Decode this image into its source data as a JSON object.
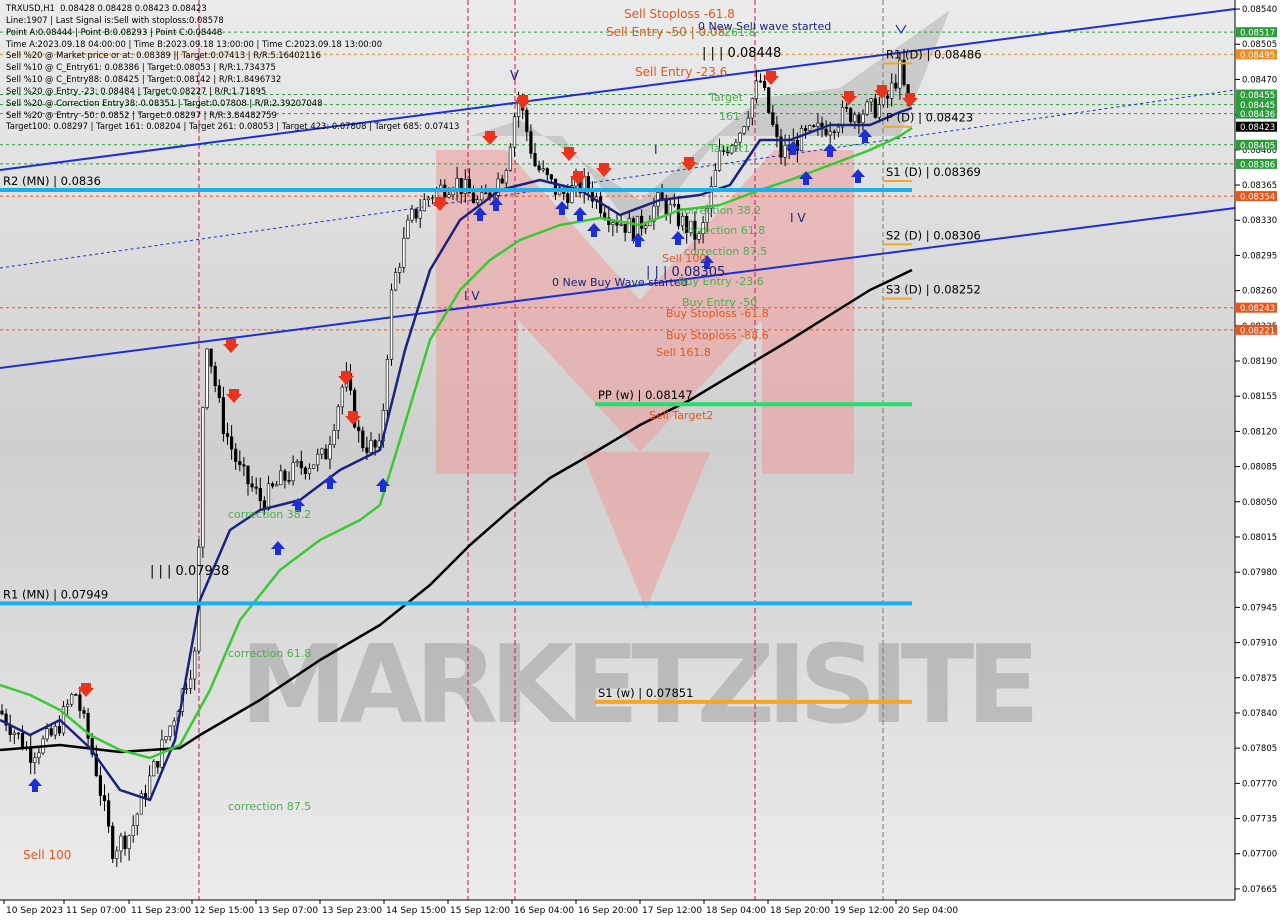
{
  "info_lines": [
    "TRXUSD,H1  0.08428 0.08428 0.08423 0.08423",
    "Line:1907 | Last Signal is:Sell with stoploss:0.08578",
    "Point A:0.08444 | Point B:0.08293 | Point C:0.08448",
    "Time A:2023.09.18 04:00:00 | Time B:2023.09.18 13:00:00 | Time C:2023.09.18 13:00:00",
    "Sell %20 @ Market price or at: 0.08389 || Target:0.07413 | R/R:5.16402116",
    "Sell %10 @ C_Entry61: 0.08386 | Target:0.08053 | R/R:1.734375",
    "Sell %10 @ C_Entry88: 0.08425 | Target:0.08142 | R/R:1.8496732",
    "Sell %20 @ Entry -23: 0.08484 | Target:0.08227 | R/R:1.71895",
    "Sell %20 @ Correction Entry38: 0.08351 | Target:0.07808 | R/R:2.39207048",
    "Sell %20 @ Entry -50: 0.0852 | Target:0.08297 | R/R:3.84482759",
    "Target100: 0.08297 | Target 161: 0.08204 | Target 261: 0.08053 | Target 423: 0.07808 | Target 685: 0.07413"
  ],
  "chart_data": {
    "type": "candlestick",
    "symbol": "TRXUSD",
    "timeframe": "H1",
    "ohlc_header": [
      0.08428,
      0.08428,
      0.08423,
      0.08423
    ],
    "ylim": [
      0.07654,
      0.08549
    ],
    "price_ticks": [
      "0.08540",
      "0.08505",
      "0.08470",
      "0.08435",
      "0.08400",
      "0.08365",
      "0.08330",
      "0.08295",
      "0.08260",
      "0.08225",
      "0.08190",
      "0.08155",
      "0.08120",
      "0.08085",
      "0.08050",
      "0.08015",
      "0.07980",
      "0.07945",
      "0.07910",
      "0.07875",
      "0.07840",
      "0.07805",
      "0.07770",
      "0.07735",
      "0.07700",
      "0.07665"
    ],
    "time_labels": [
      "10 Sep 2023",
      "11 Sep 07:00",
      "11 Sep 23:00",
      "12 Sep 15:00",
      "13 Sep 07:00",
      "13 Sep 23:00",
      "14 Sep 15:00",
      "15 Sep 12:00",
      "16 Sep 04:00",
      "16 Sep 20:00",
      "17 Sep 12:00",
      "18 Sep 04:00",
      "18 Sep 20:00",
      "19 Sep 12:00",
      "20 Sep 04:00"
    ],
    "price_badges": [
      {
        "value": "0.08517",
        "color": "#2e9b3c"
      },
      {
        "value": "0.08495",
        "color": "#f08a1c"
      },
      {
        "value": "0.08455",
        "color": "#2e9b3c"
      },
      {
        "value": "0.08445",
        "color": "#2e9b3c"
      },
      {
        "value": "0.08436",
        "color": "#2e9b3c"
      },
      {
        "value": "0.08423",
        "color": "#000000"
      },
      {
        "value": "0.08405",
        "color": "#2e9b3c"
      },
      {
        "value": "0.08386",
        "color": "#2e9b3c"
      },
      {
        "value": "0.08354",
        "color": "#e8541c"
      },
      {
        "value": "0.08243",
        "color": "#e8541c"
      },
      {
        "value": "0.08221",
        "color": "#e8541c"
      }
    ],
    "pivots": [
      {
        "label": "R2 (MN) | 0.0836",
        "value": 0.0836,
        "color": "#1ab0f0"
      },
      {
        "label": "R1 (MN) | 0.07949",
        "value": 0.07949,
        "color": "#1ab0f0"
      },
      {
        "label": "PP (w) | 0.08147",
        "value": 0.08147,
        "color": "#22e06a"
      },
      {
        "label": "S1 (w) | 0.07851",
        "value": 0.07851,
        "color": "#f5a623"
      },
      {
        "label": "R1 (D) | 0.08486",
        "value": 0.08486,
        "color": "#f5a623"
      },
      {
        "label": "P (D) | 0.08423",
        "value": 0.08423,
        "color": "#f5a623"
      },
      {
        "label": "S1 (D) | 0.08369",
        "value": 0.08369,
        "color": "#f5a623"
      },
      {
        "label": "S2 (D) | 0.08306",
        "value": 0.08306,
        "color": "#f5a623"
      },
      {
        "label": "S3 (D) | 0.08252",
        "value": 0.08252,
        "color": "#f5a623"
      }
    ],
    "annotations": [
      {
        "text": "Sell Stoploss -61.8",
        "color": "#e8541c"
      },
      {
        "text": "Sell Entry -50 | 0.08",
        "color": "#e8541c"
      },
      {
        "text": "0 New Sell wave started",
        "color": "#1a237e"
      },
      {
        "text": "261.8",
        "color": "#4caf50"
      },
      {
        "text": "| | | 0.08448",
        "color": "#000000"
      },
      {
        "text": "Sell Entry -23.6",
        "color": "#e8541c"
      },
      {
        "text": "Target",
        "color": "#4caf50"
      },
      {
        "text": "161",
        "color": "#4caf50"
      },
      {
        "text": "Target1",
        "color": "#4caf50"
      },
      {
        "text": "correction 38.2",
        "color": "#4caf50"
      },
      {
        "text": "correction 61.8",
        "color": "#4caf50"
      },
      {
        "text": "correction 87.5",
        "color": "#4caf50"
      },
      {
        "text": "Sell 100",
        "color": "#e8541c"
      },
      {
        "text": "| | | 0.08305",
        "color": "#1a237e"
      },
      {
        "text": "0 New Buy Wave started",
        "color": "#1a237e"
      },
      {
        "text": "Buy Entry -23.6",
        "color": "#4caf50"
      },
      {
        "text": "Buy Entry -50",
        "color": "#4caf50"
      },
      {
        "text": "Buy Stoploss -61.8",
        "color": "#e8541c"
      },
      {
        "text": "Buy Stoploss -88.6",
        "color": "#e8541c"
      },
      {
        "text": "Sell 161.8",
        "color": "#e8541c"
      },
      {
        "text": "Sell Target2",
        "color": "#e8541c"
      },
      {
        "text": "| | | 0.07938",
        "color": "#000000"
      },
      {
        "text": "correction 38.2",
        "color": "#4caf50"
      },
      {
        "text": "correction 61.8",
        "color": "#4caf50"
      },
      {
        "text": "correction 87.5",
        "color": "#4caf50"
      },
      {
        "text": "Sell 100",
        "color": "#e8541c"
      },
      {
        "text": "V",
        "color": "#1a237e"
      },
      {
        "text": "I V",
        "color": "#1a237e"
      },
      {
        "text": "I V",
        "color": "#1a237e"
      },
      {
        "text": "I",
        "color": "#1a237e"
      }
    ],
    "moving_averages": [
      {
        "color": "#000000"
      },
      {
        "color": "#1a237e"
      },
      {
        "color": "#39c933"
      }
    ],
    "watermark": "MARKETZISITE"
  }
}
